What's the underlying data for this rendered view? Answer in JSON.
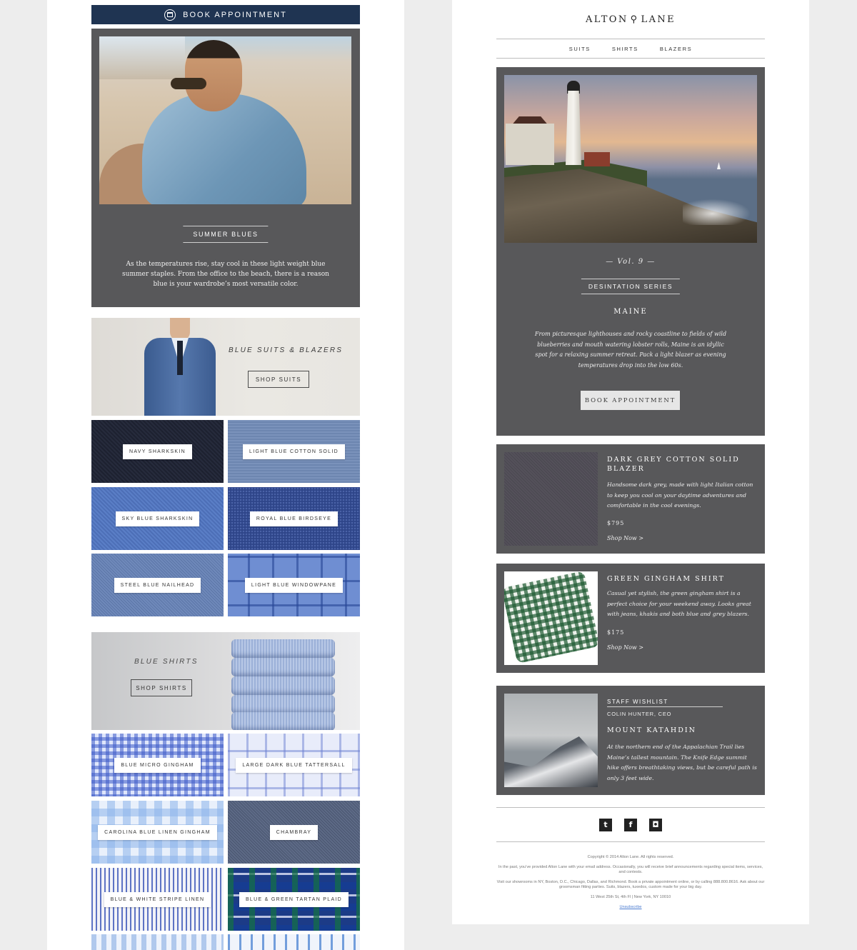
{
  "left": {
    "book_bar": {
      "label": "BOOK APPOINTMENT",
      "icon": "calendar-icon"
    },
    "summer": {
      "title": "SUMMER BLUES",
      "text": "As the temperatures rise, stay cool in these light weight blue summer staples. From the office to the beach, there is a reason blue is your wardrobe’s most versatile color."
    },
    "suits": {
      "title": "BLUE SUITS & BLAZERS",
      "button": "SHOP SUITS",
      "swatches": [
        "NAVY SHARKSKIN",
        "LIGHT BLUE COTTON SOLID",
        "SKY BLUE SHARKSKIN",
        "ROYAL BLUE BIRDSEYE",
        "STEEL BLUE NAILHEAD",
        "LIGHT BLUE WINDOWPANE"
      ]
    },
    "shirts": {
      "title": "BLUE SHIRTS",
      "button": "SHOP SHIRTS",
      "swatches": [
        "BLUE MICRO GINGHAM",
        "LARGE DARK BLUE TATTERSALL",
        "CAROLINA BLUE LINEN GINGHAM",
        "CHAMBRAY",
        "BLUE & WHITE STRIPE LINEN",
        "BLUE & GREEN TARTAN PLAID"
      ]
    }
  },
  "right": {
    "logo": {
      "left": "ALTON",
      "right": "LANE",
      "mark": "⚲"
    },
    "nav": [
      "SUITS",
      "SHIRTS",
      "BLAZERS"
    ],
    "feature": {
      "volume": "— Vol. 9 —",
      "series": "DESINTATION SERIES",
      "title": "MAINE",
      "text": "From picturesque lighthouses and rocky coastline to fields of wild blueberries and mouth watering lobster rolls, Maine is an idyllic spot for a relaxing summer retreat. Pack a light blazer as evening temperatures drop into the low 60s.",
      "button": "BOOK APPOINTMENT"
    },
    "products": [
      {
        "title": "DARK GREY COTTON SOLID BLAZER",
        "text": "Handsome dark grey, made with light Italian cotton to keep you cool on your daytime adventures and comfortable in the cool evenings.",
        "price": "$795",
        "shop": "Shop Now >"
      },
      {
        "title": "GREEN GINGHAM SHIRT",
        "text": "Casual yet stylish, the green gingham shirt is a perfect choice for your weekend away. Looks great with jeans, khakis and both blue and grey blazers.",
        "price": "$175",
        "shop": "Shop Now >"
      }
    ],
    "wishlist": {
      "label": "STAFF WISHLIST",
      "author": "COLIN HUNTER, CEO",
      "title": "MOUNT KATAHDIN",
      "text": "At the northern end of the Appalachian Trail lies Maine’s tallest mountain. The Knife Edge summit hike offers breathtaking views, but be careful path is only 3 feet wide."
    },
    "social": {
      "twitter": "t",
      "facebook": "f",
      "instagram": "◘"
    },
    "footer": {
      "copyright": "Copyright © 2014 Alton Lane. All rights reserved.",
      "notice": "In the past, you’ve provided Alton Lane with your email address. Occasionally, you will receive brief announcements regarding special items, services, and contests.",
      "visit": "Visit our showrooms in NY, Boston, D.C., Chicago, Dallas, and Richmond. Book a private appointment online, or by calling 888.800.8616. Ask about our groomsman fitting parties. Suits, blazers, tuxedos, custom made for your big day.",
      "address": "11 West 25th St, 4th Fl  |  New York, NY 10010",
      "unsubscribe": "Unsubscribe"
    }
  }
}
